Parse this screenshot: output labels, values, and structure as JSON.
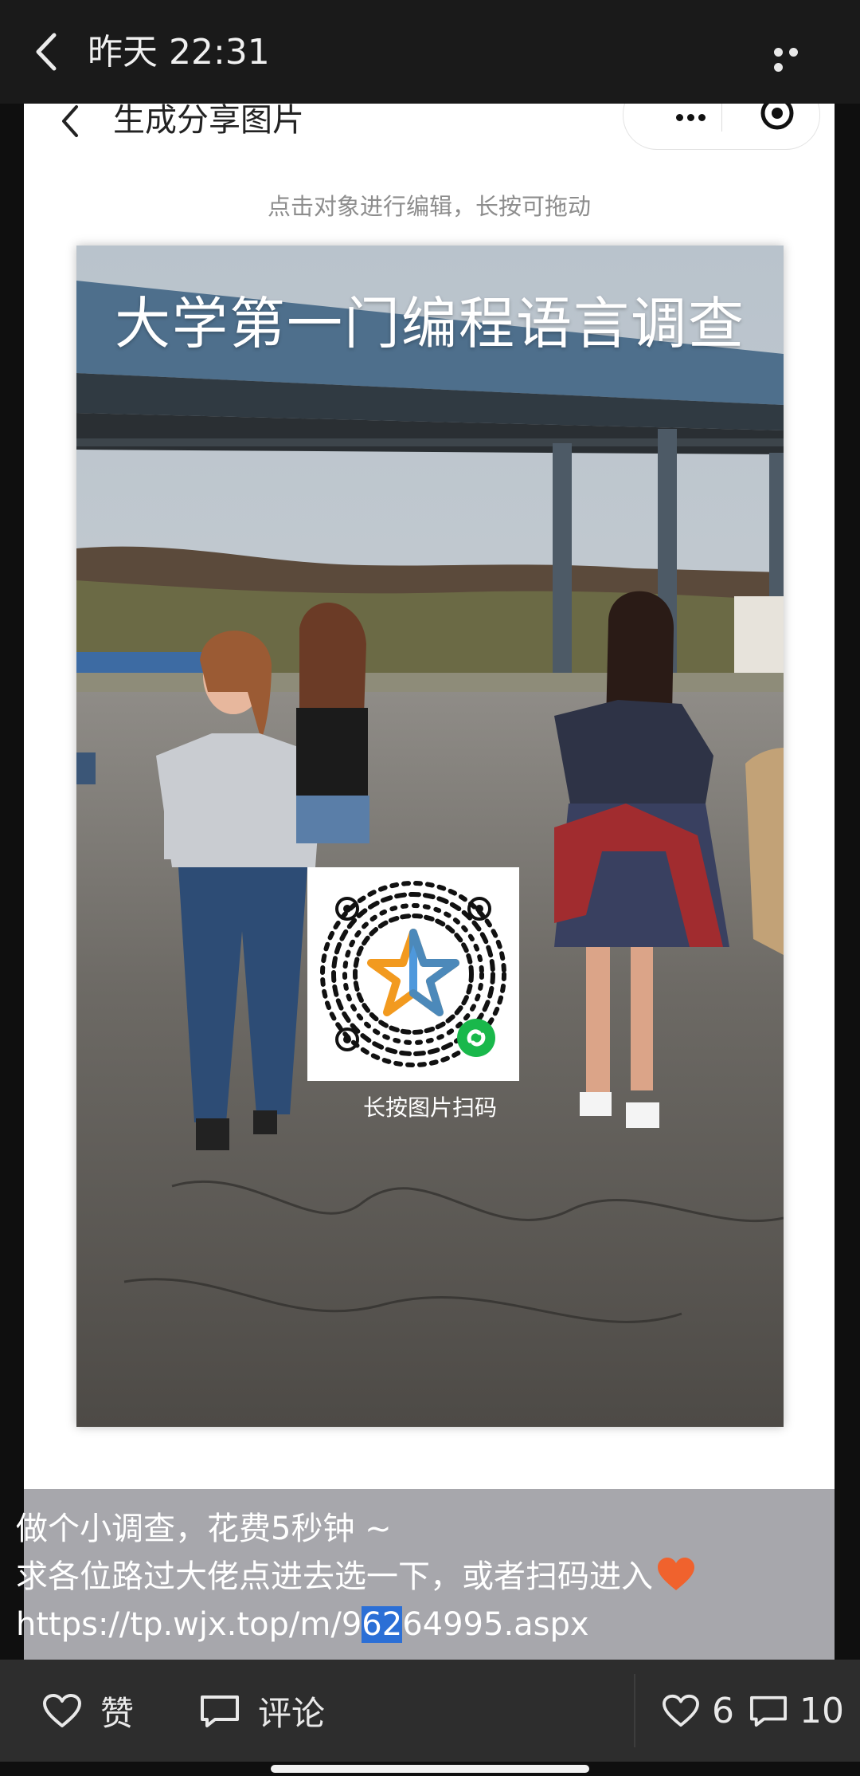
{
  "topbar": {
    "time": "昨天 22:31"
  },
  "card": {
    "title": "生成分享图片",
    "hint": "点击对象进行编辑，长按可拖动"
  },
  "poster": {
    "title": "大学第一门编程语言调查",
    "qr_caption": "长按图片扫码"
  },
  "caption": {
    "line1": "做个小调查，花费5秒钟 ~",
    "line2": "求各位路过大佬点进去选一下，或者扫码进入",
    "link_before": "https://tp.wjx.top/m/9",
    "link_selected": "62",
    "link_after": "64995.aspx"
  },
  "actions": {
    "like_label": "赞",
    "comment_label": "评论",
    "like_count": "6",
    "comment_count": "10"
  },
  "colors": {
    "heart": "#f0622d",
    "selection": "#2b6fd6",
    "qr_star_orange": "#f29a1f",
    "qr_star_blue": "#2f86d6",
    "miniprogram_green": "#19b84b"
  }
}
